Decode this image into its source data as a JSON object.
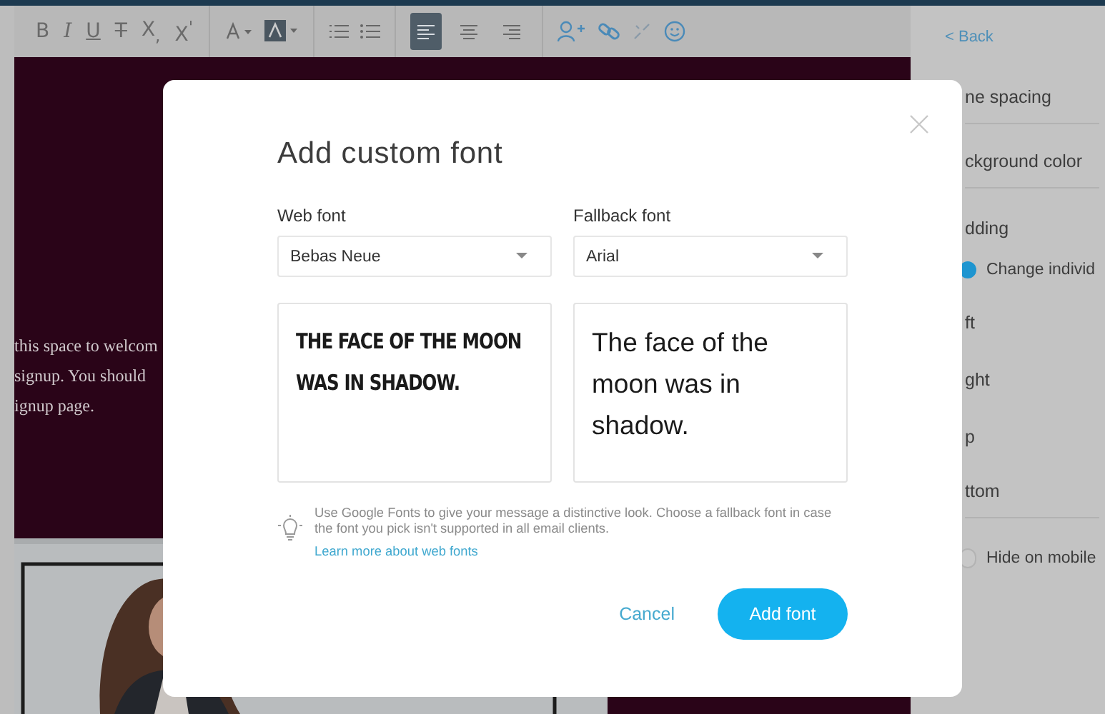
{
  "toolbar": {
    "format_buttons": [
      {
        "kind": "bold",
        "label": "B"
      },
      {
        "kind": "italic",
        "label": "I"
      },
      {
        "kind": "underline",
        "label": "U"
      },
      {
        "kind": "strike",
        "label": "T"
      },
      {
        "kind": "sub",
        "label": "X$_{,}$"
      },
      {
        "kind": "sup",
        "label": "X$^{'}$"
      }
    ],
    "align_buttons": [
      {
        "kind": "left",
        "selected": true
      },
      {
        "kind": "center",
        "selected": false
      },
      {
        "kind": "right",
        "selected": false
      }
    ]
  },
  "canvas": {
    "text_lines": [
      "this space to welcom",
      "signup. You should",
      "ignup page."
    ]
  },
  "side_panel": {
    "back_link": "< Back",
    "items": [
      {
        "kind": "label",
        "text": "ne spacing",
        "divider": true
      },
      {
        "kind": "label",
        "text": "ckground color",
        "divider": true
      },
      {
        "kind": "label",
        "text": "dding",
        "divider": false
      },
      {
        "kind": "radio",
        "text": "Change individ",
        "checked": true,
        "divider": false
      },
      {
        "kind": "label",
        "text": "ft",
        "divider": false
      },
      {
        "kind": "label",
        "text": "ght",
        "divider": false
      },
      {
        "kind": "label",
        "text": "p",
        "divider": false
      },
      {
        "kind": "label",
        "text": "ttom",
        "divider": true
      },
      {
        "kind": "toggle",
        "text": "Hide on mobile",
        "on": false,
        "divider": false
      }
    ]
  },
  "dialog": {
    "title": "Add custom font",
    "fields": [
      {
        "label": "Web font",
        "value": "Bebas Neue",
        "kind": "display",
        "preview": "THE FACE OF THE MOON WAS IN SHADOW."
      },
      {
        "label": "Fallback font",
        "value": "Arial",
        "kind": "plain",
        "preview": "The face of the moon was in shadow."
      }
    ],
    "hint": "Use Google Fonts to give your message a distinctive look. Choose a fallback font in case the font you pick isn't supported in all email clients.",
    "link": "Learn more about web fonts",
    "cancel": "Cancel",
    "confirm": "Add font"
  }
}
